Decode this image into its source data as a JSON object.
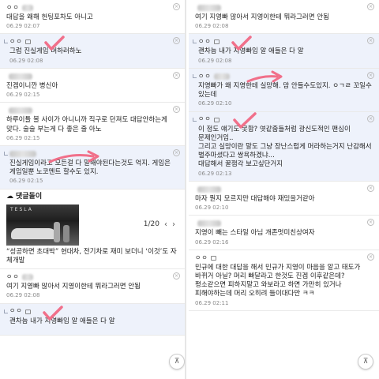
{
  "left": {
    "comments": [
      {
        "text": "대답을 왜해 헌팅포차도 아니고",
        "date": "06.29 02:07",
        "nick": "ㅇㅇ",
        "reply": false
      },
      {
        "text": "그럼 진실게임 머하러하노",
        "date": "06.29 02:08",
        "nick": "ㅇㅇ",
        "reply": true
      },
      {
        "text": "진겜이니깐 병신아",
        "date": "06.29 02:15",
        "nick": "",
        "reply": false
      },
      {
        "text": "하루이틀 볼 사이가 아니니까 직구로 던져도 대답안하는게 맞다. 술술 부는게 다 좋은 줄 아노",
        "date": "06.29 02:15",
        "nick": "",
        "reply": false
      },
      {
        "text": "진실게임이라고 모든걸 다 말해야된다는것도 억지. 게임은 게임일뿐 노코멘트 할수도 있지.",
        "date": "06.29 02:15",
        "nick": "",
        "reply": true
      }
    ],
    "news": {
      "section_title": "댓글돌이",
      "page": "1/20",
      "prev": "‹",
      "next": "›",
      "thumb_brand": "TESLA",
      "headline": "“성공하면 초대박” 현대차, 전기차로 재미 보더니 ‘이것’도 자체개발"
    },
    "comments2": [
      {
        "text": "여기 지영빠 많아서 지영이한테 뭐라그러면 안됨",
        "date": "06.29 02:08",
        "nick": "ㅇㅇ",
        "reply": false
      },
      {
        "text": "괜차늠 내가 지영빠임 알 애들은 다 알",
        "date": "",
        "nick": "ㅇㅇ",
        "reply": true
      }
    ],
    "top_label": "⊼"
  },
  "right": {
    "comments": [
      {
        "text": "여기 지영빠 많아서 지영이한테 뭐라그러면 안됨",
        "date": "06.29 02:08",
        "nick": "",
        "reply": false
      },
      {
        "text": "괜차늠 내가 지영빠임 알 애들은 다 알",
        "date": "06.29 02:08",
        "nick": "ㅇㅇ",
        "reply": true
      },
      {
        "text": "지영빠가 왜 지영한테 실망해. 맘 안들수도있지. ㅇㄱㄹ 꼬일수 있는데",
        "date": "06.29 02:10",
        "nick": "ㅇㅇ",
        "reply": true
      },
      {
        "text": "이 정도 얘기도 못함? 엿같줌들처럼 광신도적인 팬심이 문제인거임..\n그리고 실망이란 말도 그냥 장난스럽게 머라하는거지 난감해서 별주마셨다고 쌍욕하겠냐...\n대답해서 꿀잼각 보고싶단거지",
        "date": "06.29 02:13",
        "nick": "ㅇㅇ",
        "reply": true
      },
      {
        "text": "마자 뭔지 모르지만 대답해야 재밌을거같아",
        "date": "06.29 02:10",
        "nick": "",
        "reply": false
      },
      {
        "text": "지영이 빼는 스타일 아님 개존멋미친상여자",
        "date": "06.29 02:16",
        "nick": "",
        "reply": false
      },
      {
        "text": "민규에 대한 대답을 해서 민규가 지영이 마음을 알고 태도가 바뀌거 아닐? 머리 빠달라고 한것도 진겜 이후같은데? 평소같으면 피하지말고 와보라고 하면 가만히 있거나 피해야하는데 머리 오히려 들이대다만 ㅋㅋ",
        "date": "06.29 02:11",
        "nick": "ㅇㅇ",
        "reply": false
      }
    ],
    "top_label": "⊼"
  },
  "colors": {
    "accent_check": "#f1708a",
    "reply_bg": "#eef2fb"
  }
}
